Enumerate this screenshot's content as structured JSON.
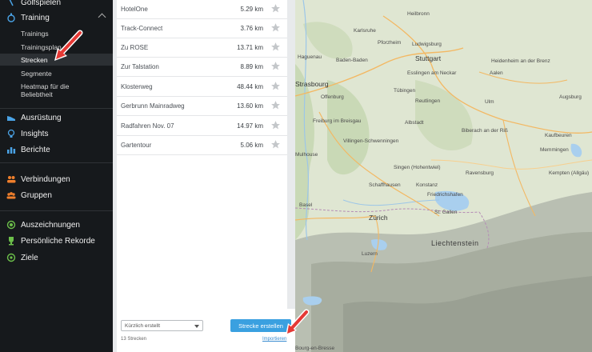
{
  "sidebar": {
    "top_item": "Golfspielen",
    "training": {
      "label": "Training",
      "sub": [
        "Trainings",
        "Trainingsplan",
        "Strecken",
        "Segmente",
        "Heatmap für die",
        "Beliebtheit"
      ]
    },
    "group2": [
      "Ausrüstung",
      "Insights",
      "Berichte"
    ],
    "group3": [
      "Verbindungen",
      "Gruppen"
    ],
    "group4": [
      "Auszeichnungen",
      "Persönliche Rekorde",
      "Ziele"
    ]
  },
  "routes": [
    {
      "name": "HotelOne",
      "distance": "5.29 km"
    },
    {
      "name": "Track-Connect",
      "distance": "3.76 km"
    },
    {
      "name": "Zu ROSE",
      "distance": "13.71 km"
    },
    {
      "name": "Zur Talstation",
      "distance": "8.89 km"
    },
    {
      "name": "Klosterweg",
      "distance": "48.44 km"
    },
    {
      "name": "Gerbrunn Mainradweg",
      "distance": "13.60 km"
    },
    {
      "name": "Radfahren Nov. 07",
      "distance": "14.97 km"
    },
    {
      "name": "Gartentour",
      "distance": "5.06 km"
    }
  ],
  "footer": {
    "sort_value": "Kürzlich erstellt",
    "create_label": "Strecke erstellen",
    "count_label": "13 Strecken",
    "import_label": "Importieren"
  },
  "map": {
    "labels": [
      "Heilbronn",
      "Karlsruhe",
      "Pforzheim",
      "Ludwigsburg",
      "Stuttgart",
      "Haguenau",
      "Baden-Baden",
      "Esslingen am Neckar",
      "Heidenheim an der Brenz",
      "Aalen",
      "Strasbourg",
      "Offenburg",
      "Tübingen",
      "Reutlingen",
      "Ulm",
      "Augsburg",
      "Freiburg im Breisgau",
      "Villingen-Schwenningen",
      "Albstadt",
      "Biberach an der Riß",
      "Memmingen",
      "Kaufbeuren",
      "Singen (Hohentwiel)",
      "Ravensburg",
      "Kempten (Allgäu)",
      "Konstanz",
      "Friedrichshafen",
      "Schaffhausen",
      "Basel",
      "Zürich",
      "St. Gallen",
      "Luzern",
      "Liechtenstein",
      "Mulhouse",
      "Bourg-en-Bresse"
    ],
    "colors": {
      "terrain": "#dfe6d2",
      "forest": "#c9d9b6",
      "mountain": "#b7bdb0",
      "lake": "#a9cfee",
      "road": "#f3b863"
    }
  }
}
